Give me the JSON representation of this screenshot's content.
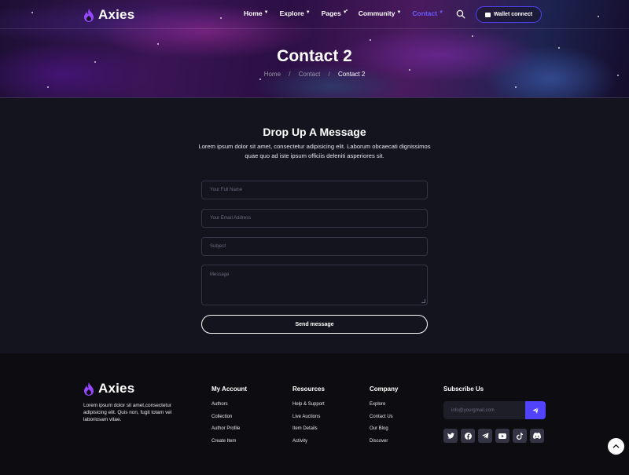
{
  "brand": {
    "name": "Axies",
    "accent": "#5142fc",
    "flame_color": "#9747ff"
  },
  "nav": {
    "items": [
      {
        "label": "Home",
        "active": false
      },
      {
        "label": "Explore",
        "active": false
      },
      {
        "label": "Pages",
        "active": false
      },
      {
        "label": "Community",
        "active": false
      },
      {
        "label": "Contact",
        "active": true
      }
    ],
    "search_icon": "search-icon",
    "wallet_label": "Wallet connect"
  },
  "hero": {
    "title": "Contact 2",
    "breadcrumb": [
      "Home",
      "Contact",
      "Contact 2"
    ],
    "separator": "/"
  },
  "contact": {
    "title": "Drop Up A Message",
    "description": "Lorem ipsum dolor sit amet, consectetur adipisicing elit. Laborum obcaecati dignissimos quae quo ad iste ipsum officiis deleniti asperiores sit.",
    "fields": {
      "name_placeholder": "Your Full Name",
      "email_placeholder": "Your Email Address",
      "subject_placeholder": "Subject",
      "message_placeholder": "Message"
    },
    "submit_label": "Send message"
  },
  "footer": {
    "brand": "Axies",
    "description": "Lorem ipsum dolor sit amet,consectetur adipisicing elit. Quis non, fugit totam vel laboriosam vitae.",
    "columns": [
      {
        "title": "My Account",
        "links": [
          "Authors",
          "Collection",
          "Author Profile",
          "Create Item"
        ]
      },
      {
        "title": "Resources",
        "links": [
          "Help & Support",
          "Live Auctions",
          "Item Details",
          "Activity"
        ]
      },
      {
        "title": "Company",
        "links": [
          "Explore",
          "Contact Us",
          "Our Blog",
          "Discover"
        ]
      }
    ],
    "subscribe": {
      "title": "Subscribe Us",
      "placeholder": "info@yourgmail.com",
      "button_icon": "send-icon"
    },
    "socials": [
      "twitter-icon",
      "facebook-icon",
      "telegram-icon",
      "youtube-icon",
      "tiktok-icon",
      "discord-icon"
    ]
  },
  "back_to_top_icon": "arrow-up-icon"
}
